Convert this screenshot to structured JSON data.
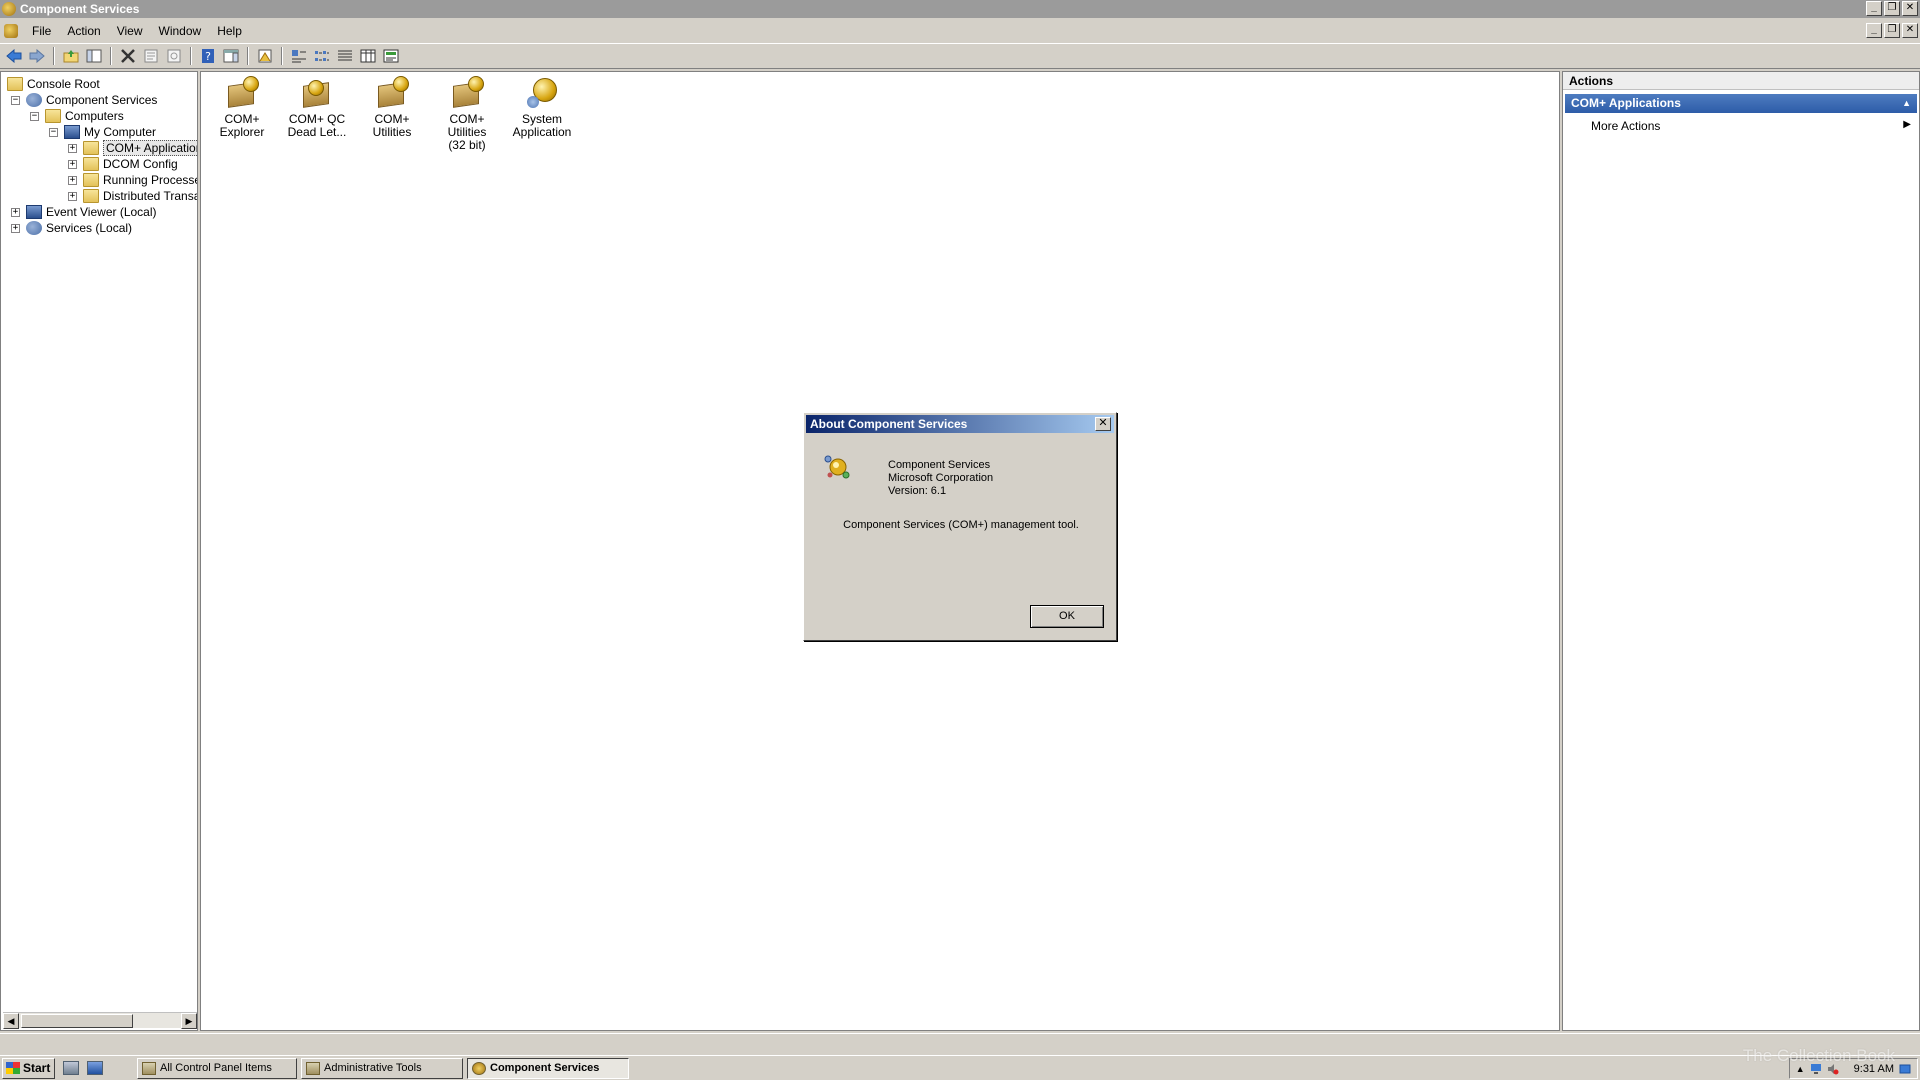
{
  "window": {
    "title": "Component Services"
  },
  "menu": {
    "items": [
      "File",
      "Action",
      "View",
      "Window",
      "Help"
    ]
  },
  "toolbar": {
    "buttons": [
      "back-icon",
      "forward-icon",
      "up-folder-icon",
      "show-hide-tree-icon",
      "delete-icon",
      "properties-icon",
      "refresh-icon",
      "help-icon",
      "show-hide-action-pane-icon",
      "export-list-icon",
      "large-icons-view-icon",
      "small-icons-view-icon",
      "list-view-icon",
      "detail-view-icon",
      "status-view-icon"
    ]
  },
  "tree": {
    "items": [
      {
        "label": "Console Root",
        "level": 0,
        "expander": "",
        "icon": "folder-icon"
      },
      {
        "label": "Component Services",
        "level": 0,
        "expander": "−",
        "icon": "component-services-icon"
      },
      {
        "label": "Computers",
        "level": 1,
        "expander": "−",
        "icon": "folder-icon"
      },
      {
        "label": "My Computer",
        "level": 2,
        "expander": "−",
        "icon": "computer-icon"
      },
      {
        "label": "COM+ Applications",
        "level": 3,
        "expander": "+",
        "icon": "folder-icon",
        "selected": true
      },
      {
        "label": "DCOM Config",
        "level": 3,
        "expander": "+",
        "icon": "folder-icon"
      },
      {
        "label": "Running Processes",
        "level": 3,
        "expander": "+",
        "icon": "folder-icon"
      },
      {
        "label": "Distributed Transac",
        "level": 3,
        "expander": "+",
        "icon": "folder-icon"
      },
      {
        "label": "Event Viewer (Local)",
        "level": 0,
        "expander": "+",
        "icon": "event-viewer-icon"
      },
      {
        "label": "Services (Local)",
        "level": 0,
        "expander": "+",
        "icon": "services-icon"
      }
    ]
  },
  "content": {
    "icons": [
      {
        "label1": "COM+",
        "label2": "Explorer",
        "icon": "com-app-icon"
      },
      {
        "label1": "COM+ QC",
        "label2": "Dead Let...",
        "icon": "com-app-icon"
      },
      {
        "label1": "COM+ Utilities",
        "label2": "",
        "icon": "com-app-icon"
      },
      {
        "label1": "COM+ Utilities",
        "label2": "(32 bit)",
        "icon": "com-app-icon"
      },
      {
        "label1": "System",
        "label2": "Application",
        "icon": "system-app-icon"
      }
    ]
  },
  "actions": {
    "header": "Actions",
    "section": "COM+ Applications",
    "more": "More Actions"
  },
  "dialog": {
    "title": "About Component Services",
    "line1": "Component Services",
    "line2": "Microsoft Corporation",
    "line3": "Version: 6.1",
    "description": "Component Services (COM+) management tool.",
    "ok": "OK"
  },
  "taskbar": {
    "start": "Start",
    "tasks": [
      "All Control Panel Items",
      "Administrative Tools",
      "Component Services"
    ],
    "active_task": "Component Services",
    "clock": "9:31 AM"
  },
  "watermark": "The Collection Book",
  "colors": {
    "title_bar": "#9b9b9b",
    "dialog_title_start": "#0a246a",
    "actions_section": "#2d5ca8",
    "chrome": "#d4d0c8"
  }
}
